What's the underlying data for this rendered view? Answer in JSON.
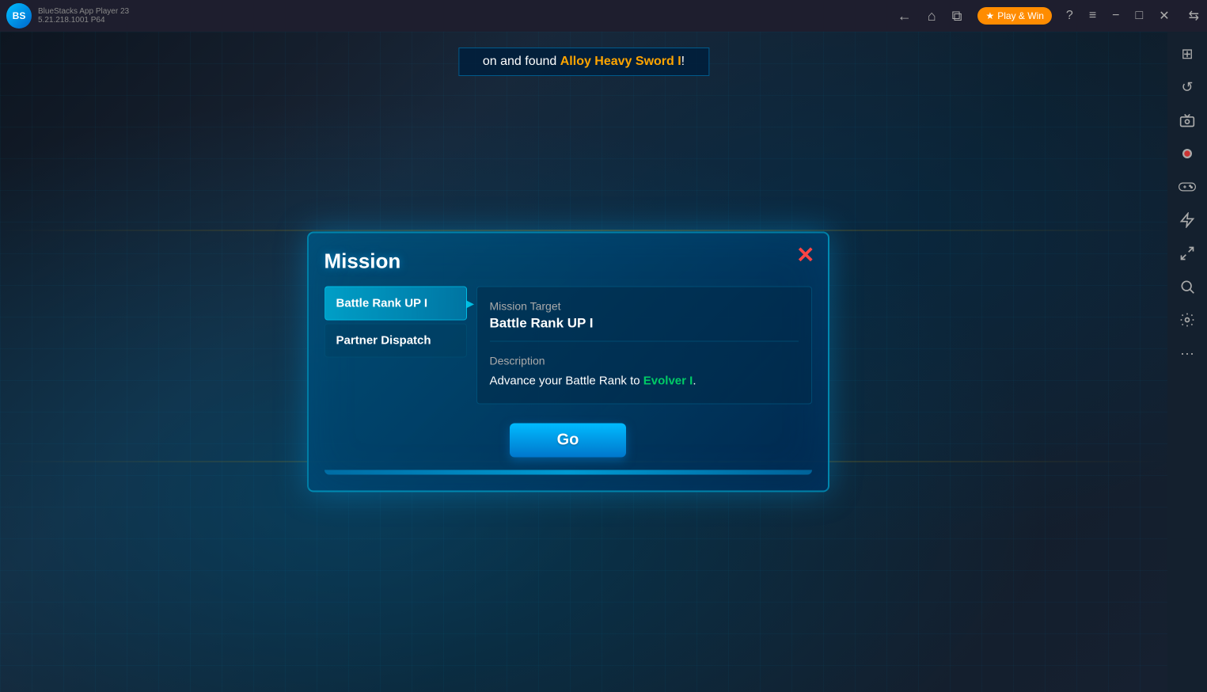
{
  "titlebar": {
    "logo_text": "BS",
    "app_name": "BlueStacks App Player 23",
    "app_version": "5.21.218.1001 P64",
    "nav": {
      "back": "←",
      "home": "⌂",
      "tabs": "⧉"
    },
    "playnwin": {
      "icon": "★",
      "label": "Play & Win"
    },
    "controls": {
      "help": "?",
      "menu": "≡",
      "minimize": "−",
      "maximize": "□",
      "close": "✕",
      "sidebar_expand": "⇆"
    }
  },
  "notification": {
    "prefix": "on and found ",
    "item_name": "Alloy Heavy Sword I",
    "suffix": "!"
  },
  "mission_dialog": {
    "title": "Mission",
    "close_icon": "✕",
    "tabs": [
      {
        "label": "Battle Rank UP I",
        "active": true
      },
      {
        "label": "Partner Dispatch",
        "active": false
      }
    ],
    "content": {
      "target_label": "Mission Target",
      "target_value": "Battle Rank UP I",
      "description_label": "Description",
      "description_text": "Advance your Battle Rank to ",
      "description_highlight": "Evolver I",
      "description_suffix": "."
    },
    "go_button": "Go"
  },
  "sidebar": {
    "icons": [
      {
        "name": "multi-instance-icon",
        "symbol": "⊞"
      },
      {
        "name": "refresh-icon",
        "symbol": "↺"
      },
      {
        "name": "screenshot-icon",
        "symbol": "📷"
      },
      {
        "name": "record-icon",
        "symbol": "⏺"
      },
      {
        "name": "gamepad-icon",
        "symbol": "🎮"
      },
      {
        "name": "macro-icon",
        "symbol": "⚡"
      },
      {
        "name": "resize-icon",
        "symbol": "⤢"
      },
      {
        "name": "search-icon",
        "symbol": "🔍"
      },
      {
        "name": "settings-icon",
        "symbol": "⚙"
      },
      {
        "name": "more-icon",
        "symbol": "…"
      }
    ]
  }
}
